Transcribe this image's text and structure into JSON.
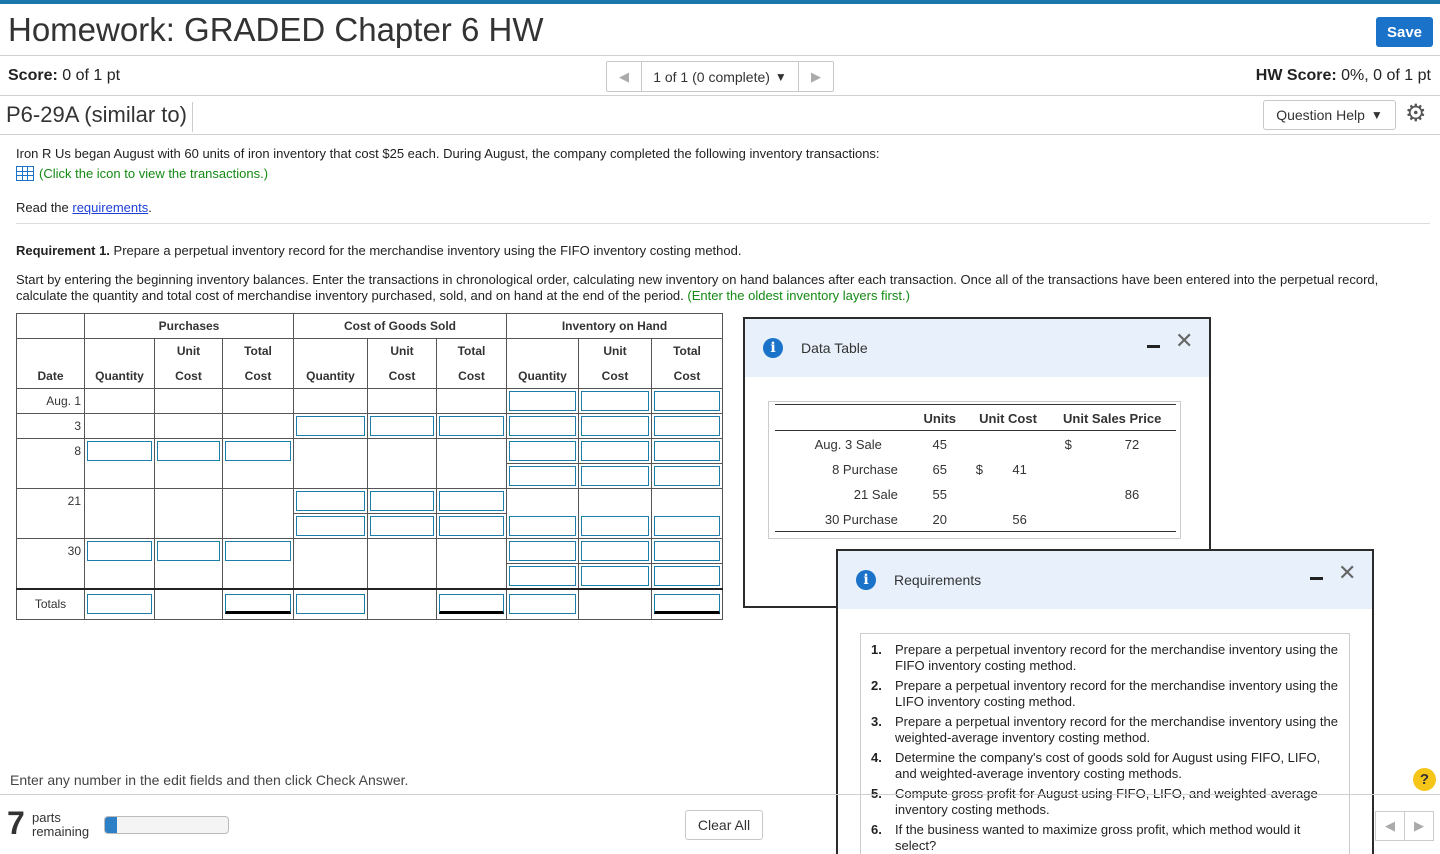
{
  "header": {
    "title": "Homework: GRADED Chapter 6 HW",
    "save_label": "Save"
  },
  "status": {
    "score_label": "Score:",
    "score_value": "0 of 1 pt",
    "pager_text": "1 of 1 (0 complete)",
    "hw_score_label": "HW Score:",
    "hw_score_value": "0%, 0 of 1 pt"
  },
  "question": {
    "id": "P6-29A (similar to)",
    "help_label": "Question Help"
  },
  "content": {
    "intro": "Iron R Us began August with 60 units of iron inventory that cost $25 each. During August, the company completed the following inventory transactions:",
    "click_icon": "(Click the icon to view the transactions.)",
    "read_prefix": "Read the ",
    "read_link": "requirements",
    "read_suffix": ".",
    "req_label": "Requirement 1.",
    "req_text": " Prepare a perpetual inventory record for the merchandise inventory using the FIFO inventory costing method.",
    "instructions": "Start by entering the beginning inventory balances. Enter the transactions in chronological order, calculating new inventory on hand balances after each transaction. Once all of the transactions have been entered into the perpetual record, calculate the quantity and total cost of merchandise inventory purchased, sold, and on hand at the end of the period.",
    "instructions_green": "(Enter the oldest inventory layers first.)"
  },
  "perpetual": {
    "groups": [
      "Purchases",
      "Cost of Goods Sold",
      "Inventory on Hand"
    ],
    "sub_top": [
      "Unit",
      "Total"
    ],
    "headers": [
      "Date",
      "Quantity",
      "Cost",
      "Cost",
      "Quantity",
      "Cost",
      "Cost",
      "Quantity",
      "Cost",
      "Cost"
    ],
    "dates": [
      "Aug. 1",
      "3",
      "8",
      "21",
      "30"
    ],
    "totals_label": "Totals"
  },
  "data_table": {
    "title": "Data Table",
    "headers": [
      "Units",
      "Unit Cost",
      "Unit Sales Price"
    ],
    "rows": [
      {
        "label": "Aug. 3 Sale",
        "units": "45",
        "cost_sym": "",
        "cost": "",
        "price_sym": "$",
        "price": "72"
      },
      {
        "label": "8 Purchase",
        "units": "65",
        "cost_sym": "$",
        "cost": "41",
        "price_sym": "",
        "price": ""
      },
      {
        "label": "21 Sale",
        "units": "55",
        "cost_sym": "",
        "cost": "",
        "price_sym": "",
        "price": "86"
      },
      {
        "label": "30 Purchase",
        "units": "20",
        "cost_sym": "",
        "cost": "56",
        "price_sym": "",
        "price": ""
      }
    ]
  },
  "requirements": {
    "title": "Requirements",
    "items": [
      "Prepare a perpetual inventory record for the merchandise inventory using the FIFO inventory costing method.",
      "Prepare a perpetual inventory record for the merchandise inventory using the LIFO inventory costing method.",
      "Prepare a perpetual inventory record for the merchandise inventory using the weighted-average inventory costing method.",
      "Determine the company's cost of goods sold for August using FIFO, LIFO, and weighted-average inventory costing methods.",
      "Compute gross profit for August using FIFO, LIFO, and weighted-average inventory costing methods.",
      "If the business wanted to maximize gross profit, which method would it select?"
    ]
  },
  "footer": {
    "hint": "Enter any number in the edit fields and then click Check Answer.",
    "parts_num": "7",
    "parts_label_1": "parts",
    "parts_label_2": "remaining",
    "progress_fraction": 0.1,
    "clear_label": "Clear All",
    "help_symbol": "?"
  },
  "icons": {
    "grid": "table-grid-icon",
    "gear": "gear-icon",
    "info": "info-icon",
    "minimize": "minimize-icon",
    "close": "close-icon",
    "prev": "chevron-left-icon",
    "next": "chevron-right-icon",
    "dropdown": "caret-down-icon"
  },
  "colors": {
    "accent": "#1a73c9",
    "green": "#138a13",
    "link": "#1e3fd7",
    "header_bar": "#1b76a9",
    "help": "#f5c518"
  }
}
